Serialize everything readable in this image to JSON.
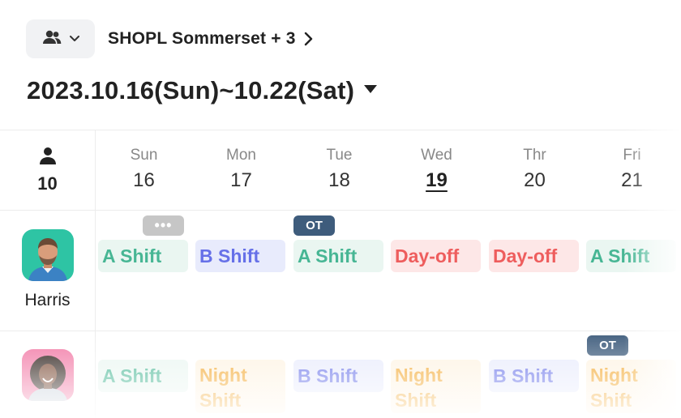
{
  "header": {
    "group_icon": "people-icon",
    "store_name": "SHOPL Sommerset + 3",
    "date_range": "2023.10.16(Sun)~10.22(Sat)"
  },
  "calendar": {
    "count_icon": "person-icon",
    "employee_count": "10",
    "days": [
      {
        "name": "Sun",
        "date": "16",
        "today": false
      },
      {
        "name": "Mon",
        "date": "17",
        "today": false
      },
      {
        "name": "Tue",
        "date": "18",
        "today": false
      },
      {
        "name": "Wed",
        "date": "19",
        "today": true
      },
      {
        "name": "Thr",
        "date": "20",
        "today": false
      },
      {
        "name": "Fri",
        "date": "21",
        "today": false
      }
    ]
  },
  "employees": [
    {
      "name": "Harris",
      "shifts": [
        {
          "label": "A Shift",
          "type": "a",
          "badge": "•••"
        },
        {
          "label": "B Shift",
          "type": "b",
          "badge": ""
        },
        {
          "label": "A Shift",
          "type": "a",
          "badge": "OT"
        },
        {
          "label": "Day-off",
          "type": "off",
          "badge": ""
        },
        {
          "label": "Day-off",
          "type": "off",
          "badge": ""
        },
        {
          "label": "A Shift",
          "type": "a",
          "badge": ""
        }
      ]
    },
    {
      "name": "",
      "shifts": [
        {
          "label": "A Shift",
          "type": "a",
          "badge": ""
        },
        {
          "label": "Night Shift",
          "type": "night",
          "badge": ""
        },
        {
          "label": "B Shift",
          "type": "b",
          "badge": ""
        },
        {
          "label": "Night Shift",
          "type": "night",
          "badge": ""
        },
        {
          "label": "B Shift",
          "type": "b",
          "badge": ""
        },
        {
          "label": "Night Shift",
          "type": "night",
          "badge": "OT"
        }
      ]
    }
  ],
  "colors": {
    "a_shift": "#47b694",
    "b_shift": "#6670e8",
    "day_off": "#ee5d5d",
    "night_shift": "#f2a528",
    "ot_badge": "#3e5c7c"
  }
}
